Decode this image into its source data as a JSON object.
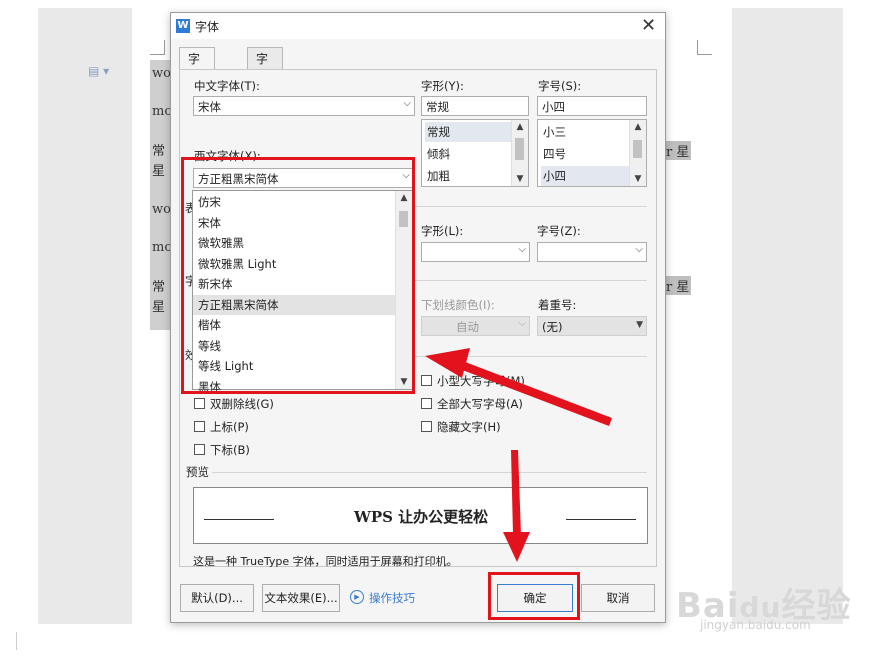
{
  "document": {
    "left_lines": [
      "wo",
      "mo",
      "常",
      "星",
      "wo",
      "mo",
      "常",
      "星"
    ],
    "right_lines": [
      "r 星",
      "r 星"
    ],
    "fragments": [
      "表",
      "字",
      "效"
    ]
  },
  "dialog": {
    "title": "字体",
    "app_icon": "W",
    "close_glyph": "✕",
    "tabs": [
      {
        "label": "字体(N)",
        "active": true
      },
      {
        "label": "字符间距(R)",
        "active": false
      }
    ],
    "chinese_font": {
      "label": "中文字体(T):",
      "value": "宋体"
    },
    "style": {
      "label": "字形(Y):",
      "value": "常规",
      "items": [
        {
          "text": "常规",
          "selected": true
        },
        {
          "text": "倾斜",
          "selected": false
        },
        {
          "text": "加粗",
          "selected": false
        }
      ]
    },
    "size": {
      "label": "字号(S):",
      "value": "小四",
      "items": [
        {
          "text": "小三",
          "selected": false
        },
        {
          "text": "四号",
          "selected": false
        },
        {
          "text": "小四",
          "selected": true
        }
      ]
    },
    "western_font": {
      "label": "西文字体(X):",
      "value": "方正粗黑宋简体"
    },
    "complex_style": {
      "label": "字形(L):",
      "value": ""
    },
    "complex_size": {
      "label": "字号(Z):",
      "value": ""
    },
    "underline_color": {
      "label": "下划线颜色(I):",
      "value": "自动"
    },
    "emphasis": {
      "label": "着重号:",
      "value": "(无)"
    },
    "font_dropdown": {
      "items": [
        {
          "text": "仿宋",
          "highlighted": false
        },
        {
          "text": "宋体",
          "highlighted": false
        },
        {
          "text": "微软雅黑",
          "highlighted": false
        },
        {
          "text": "微软雅黑 Light",
          "highlighted": false
        },
        {
          "text": "新宋体",
          "highlighted": false
        },
        {
          "text": "方正粗黑宋简体",
          "highlighted": true
        },
        {
          "text": "楷体",
          "highlighted": false
        },
        {
          "text": "等线",
          "highlighted": false
        },
        {
          "text": "等线 Light",
          "highlighted": false
        },
        {
          "text": "黑体",
          "highlighted": false
        }
      ]
    },
    "effects_left": [
      {
        "label": "双删除线(G)",
        "checked": false
      },
      {
        "label": "上标(P)",
        "checked": false
      },
      {
        "label": "下标(B)",
        "checked": false
      }
    ],
    "effects_right": [
      {
        "label": "小型大写字母(M)",
        "checked": false
      },
      {
        "label": "全部大写字母(A)",
        "checked": false
      },
      {
        "label": "隐藏文字(H)",
        "checked": false
      }
    ],
    "preview": {
      "label": "预览",
      "text": "WPS 让办公更轻松",
      "description": "这是一种 TrueType 字体，同时适用于屏幕和打印机。"
    },
    "buttons": {
      "default": "默认(D)...",
      "text_effects": "文本效果(E)...",
      "tips": "操作技巧",
      "ok": "确定",
      "cancel": "取消"
    }
  },
  "annotations": {
    "highlight_color": "#e3131e"
  },
  "watermark": {
    "brand": "Bai",
    "brand_cn": "经验",
    "url": "jingyan.baidu.com"
  }
}
